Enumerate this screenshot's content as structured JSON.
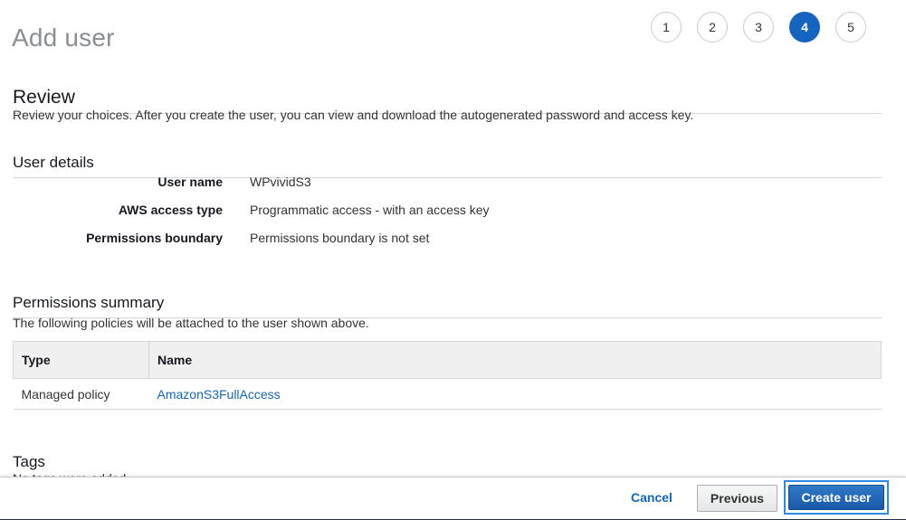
{
  "page": {
    "title": "Add user"
  },
  "steps": [
    {
      "label": "1",
      "active": false
    },
    {
      "label": "2",
      "active": false
    },
    {
      "label": "3",
      "active": false
    },
    {
      "label": "4",
      "active": true
    },
    {
      "label": "5",
      "active": false
    }
  ],
  "review": {
    "heading": "Review",
    "description": "Review your choices. After you create the user, you can view and download the autogenerated password and access key."
  },
  "user_details": {
    "heading": "User details",
    "rows": [
      {
        "label": "User name",
        "value": "WPvividS3"
      },
      {
        "label": "AWS access type",
        "value": "Programmatic access - with an access key"
      },
      {
        "label": "Permissions boundary",
        "value": "Permissions boundary is not set"
      }
    ]
  },
  "permissions_summary": {
    "heading": "Permissions summary",
    "description": "The following policies will be attached to the user shown above.",
    "columns": [
      "Type",
      "Name"
    ],
    "rows": [
      {
        "type": "Managed policy",
        "name": "AmazonS3FullAccess"
      }
    ]
  },
  "tags": {
    "heading": "Tags",
    "partial_text": "No tags were added."
  },
  "footer": {
    "cancel_label": "Cancel",
    "previous_label": "Previous",
    "create_label": "Create user"
  },
  "colors": {
    "accent": "#1565c0",
    "link": "#1166bb",
    "focus_ring": "#2e8be5"
  }
}
